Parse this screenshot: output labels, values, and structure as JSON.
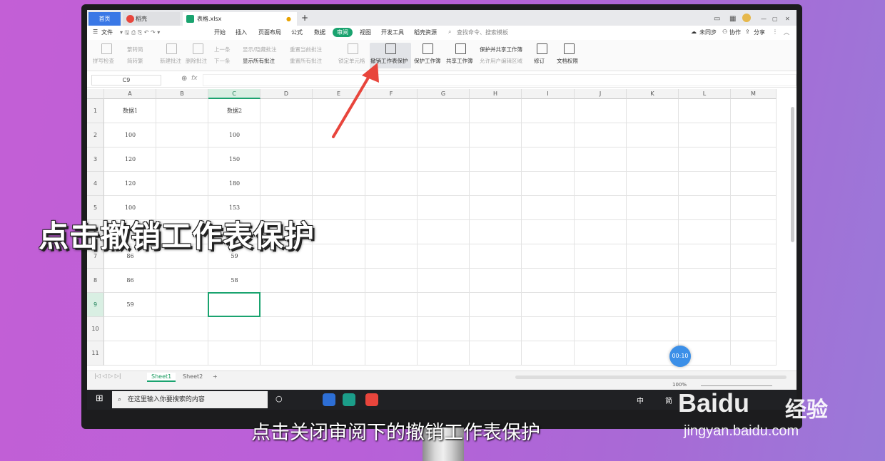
{
  "tabs": {
    "home": "首页",
    "docer": "稻壳",
    "file": "表格.xlsx",
    "new_tab": "+"
  },
  "menu": {
    "file": "文件",
    "items": [
      "开始",
      "插入",
      "页面布局",
      "公式",
      "数据",
      "审阅",
      "视图",
      "开发工具",
      "稻壳资源"
    ],
    "active": "审阅",
    "search": "查找命令、搜索模板",
    "sync": "未同步",
    "collab": "协作",
    "share": "分享"
  },
  "ribbon": {
    "spell": "拼写检查",
    "simp_to_trad": "繁转简",
    "trad_to_simp": "简转繁",
    "new_comment": "新建批注",
    "delete_comment": "删除批注",
    "prev": "上一条",
    "next": "下一条",
    "show_hide_comment": "显示/隐藏批注",
    "show_all_comments": "显示所有批注",
    "reset_current": "重置当前批注",
    "reset_all": "重置所有批注",
    "lock_cell": "锁定单元格",
    "unprotect_sheet": "撤销工作表保护",
    "protect_workbook": "保护工作簿",
    "share_workbook": "共享工作簿",
    "protect_and_share": "保护并共享工作簿",
    "allow_edit_ranges": "允许用户编辑区域",
    "track_changes": "修订",
    "doc_permissions": "文档权限"
  },
  "formula_bar": {
    "name_box": "C9",
    "fx": "fx"
  },
  "columns": [
    "A",
    "B",
    "C",
    "D",
    "E",
    "F",
    "G",
    "H",
    "I",
    "J",
    "K",
    "L",
    "M"
  ],
  "rows": [
    "1",
    "2",
    "3",
    "4",
    "5",
    "6",
    "7",
    "8",
    "9",
    "10",
    "11"
  ],
  "selected_cell": "C9",
  "cells": {
    "A1": "数据1",
    "C1": "数据2",
    "A2": "100",
    "C2": "100",
    "A3": "120",
    "C3": "150",
    "A4": "120",
    "C4": "180",
    "A5": "100",
    "C5": "153",
    "A7": "86",
    "C7": "59",
    "A8": "86",
    "C8": "58",
    "A9": "59"
  },
  "sheets": [
    "Sheet1",
    "Sheet2"
  ],
  "active_sheet": "Sheet1",
  "status": {
    "zoom": "100%"
  },
  "taskbar": {
    "search_placeholder": "在这里输入你要搜索的内容",
    "ime": "中",
    "ime2": "简"
  },
  "timer": "00:10",
  "overlay": {
    "title": "点击撤销工作表保护",
    "subtitle": "点击关闭审阅下的撤销工作表保护"
  },
  "watermark": {
    "brand": "Baidu",
    "brand_cn": "经验",
    "url": "jingyan.baidu.com"
  },
  "colors": {
    "accent": "#1aa36f",
    "home_tab": "#3a78e6",
    "arrow": "#e8453c",
    "background": "#b860d8"
  }
}
